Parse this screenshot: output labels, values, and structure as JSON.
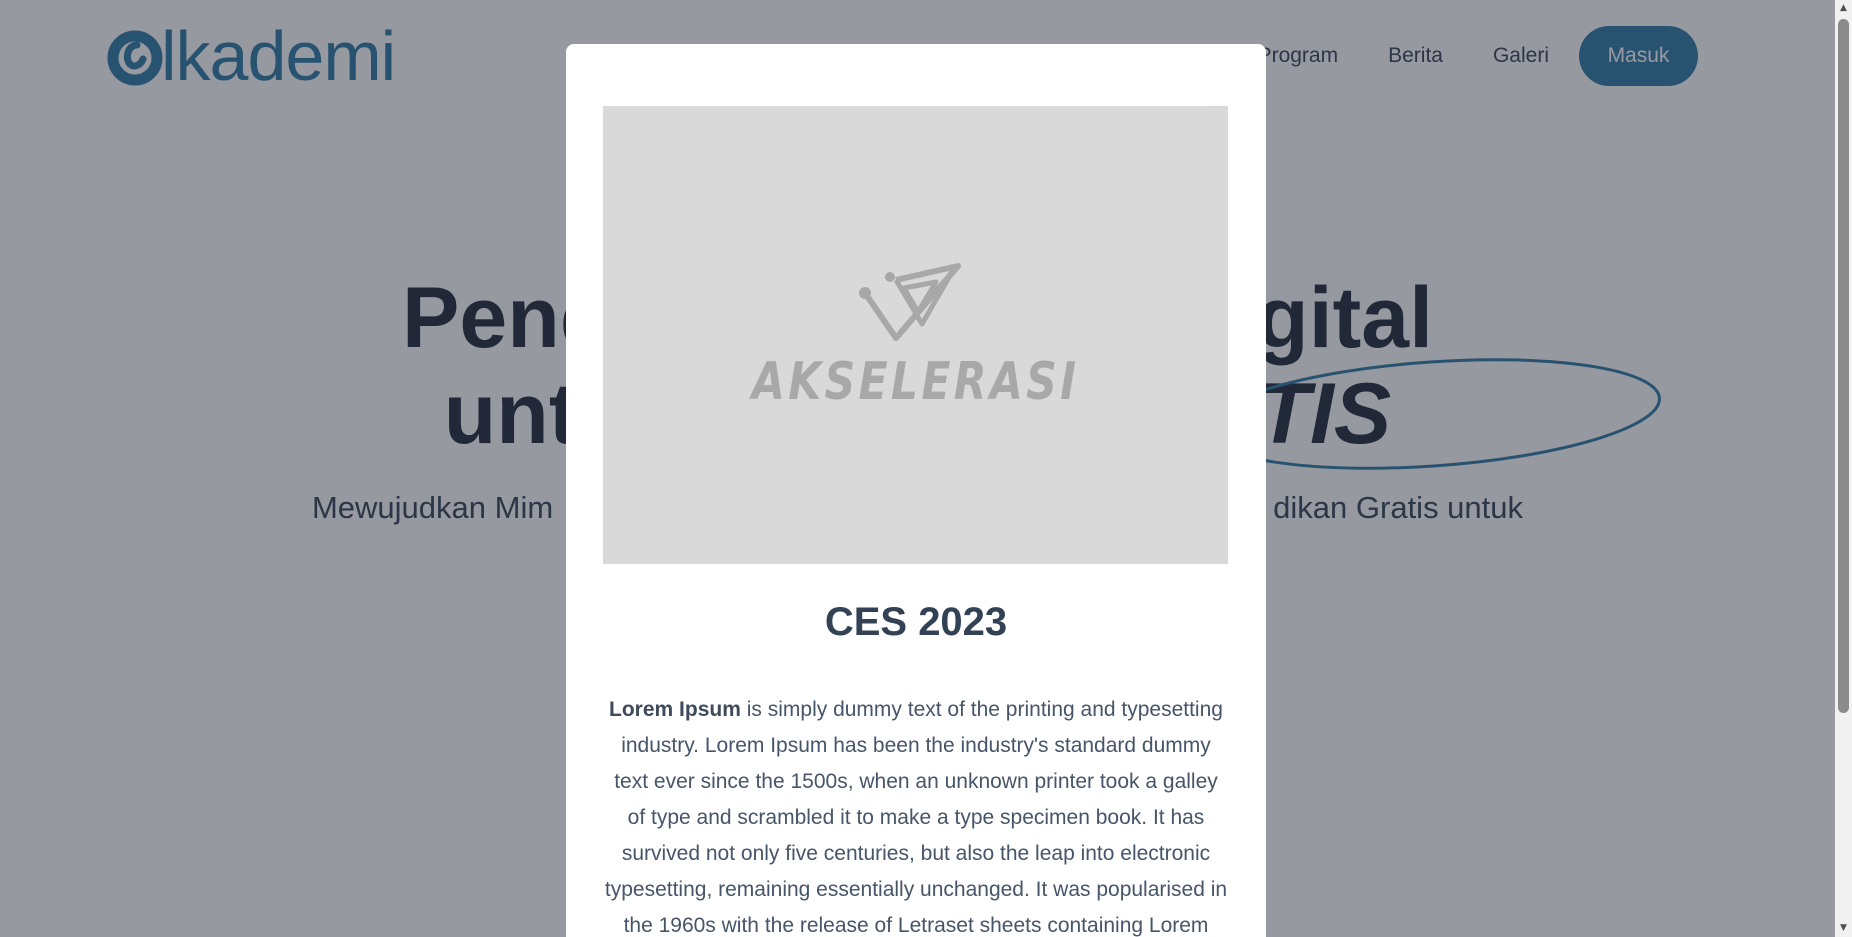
{
  "header": {
    "logo_text": "lkademi",
    "nav": [
      {
        "label": "Program"
      },
      {
        "label": "Berita"
      },
      {
        "label": "Galeri"
      }
    ],
    "login_label": "Masuk"
  },
  "hero": {
    "line1_start": "Pend",
    "line1_end": "igital",
    "line2_start": "unt",
    "line2_highlight": "TIS",
    "subtitle_start": "Mewujudkan Mim",
    "subtitle_end": "dikan Gratis untuk"
  },
  "modal": {
    "close_glyph": "×",
    "image_logo_text": "AKSELERASI",
    "title": "CES 2023",
    "body_bold": "Lorem Ipsum",
    "body_text": " is simply dummy text of the printing and typesetting industry. Lorem Ipsum has been the industry's standard dummy text ever since the 1500s, when an unknown printer took a galley of type and scrambled it to make a type specimen book. It has survived not only five centuries, but also the leap into electronic typesetting, remaining essentially unchanged. It was popularised in the 1960s with the release of Letraset sheets containing Lorem"
  },
  "scrollbar": {
    "up_glyph": "▲",
    "down_glyph": "▼"
  },
  "colors": {
    "brand": "#2b7aa3",
    "overlay": "rgba(38, 42, 56, 0.48)",
    "heading": "#1e293b",
    "image_placeholder": "#d9d9d9"
  }
}
